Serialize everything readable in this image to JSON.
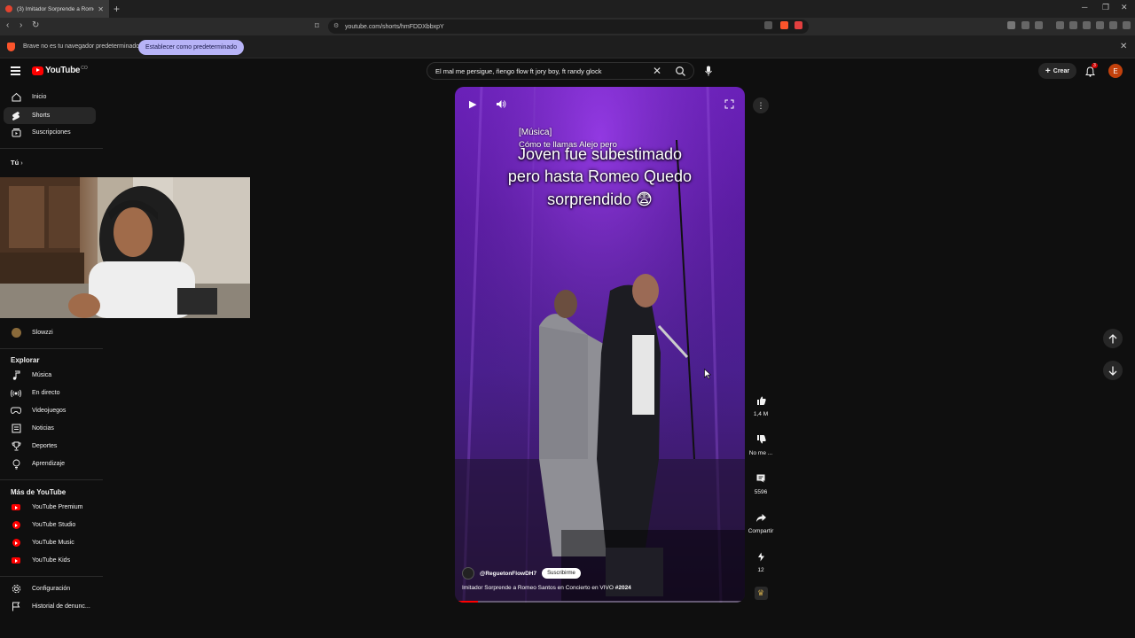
{
  "browser": {
    "tab_title": "(3) Imitador Sorprende a Romeo",
    "url": "youtube.com/shorts/hmFDDXbbxpY",
    "notification_message": "Brave no es tu navegador predeterminado",
    "set_default_label": "Establecer como predeterminado"
  },
  "header": {
    "logo_text": "YouTube",
    "logo_suffix": "CO",
    "search_query": "El mal me persigue, ñengo flow ft jory boy, ft randy glock",
    "create_label": "Crear",
    "notification_count": "3",
    "avatar_letter": "E"
  },
  "sidebar": {
    "main": [
      {
        "label": "Inicio",
        "icon": "home-icon"
      },
      {
        "label": "Shorts",
        "icon": "shorts-icon",
        "active": true
      },
      {
        "label": "Suscripciones",
        "icon": "subscriptions-icon"
      }
    ],
    "you_label": "Tú",
    "subscription_item": "Slowzzi",
    "explore_heading": "Explorar",
    "explore": [
      {
        "label": "Música",
        "icon": "music-icon"
      },
      {
        "label": "En directo",
        "icon": "live-icon"
      },
      {
        "label": "Videojuegos",
        "icon": "gaming-icon"
      },
      {
        "label": "Noticias",
        "icon": "news-icon"
      },
      {
        "label": "Deportes",
        "icon": "trophy-icon"
      },
      {
        "label": "Aprendizaje",
        "icon": "bulb-icon"
      }
    ],
    "more_heading": "Más de YouTube",
    "more": [
      {
        "label": "YouTube Premium",
        "icon": "youtube-premium-icon"
      },
      {
        "label": "YouTube Studio",
        "icon": "youtube-studio-icon"
      },
      {
        "label": "YouTube Music",
        "icon": "youtube-music-icon"
      },
      {
        "label": "YouTube Kids",
        "icon": "youtube-kids-icon"
      }
    ],
    "bottom": [
      {
        "label": "Configuración",
        "icon": "settings-icon"
      },
      {
        "label": "Historial de denunc...",
        "icon": "flag-icon"
      }
    ]
  },
  "video": {
    "caption_line1": "[Música]",
    "caption_line2": "Cómo te llamas Alejo pero",
    "overlay_text_1": "Joven fue subestimado",
    "overlay_text_2": "pero hasta Romeo Quedo",
    "overlay_text_3": "sorprendido 😨",
    "channel": "@ReguetonFlowDH7",
    "subscribe_label": "Suscribirme",
    "title": "Imitador Sorprende a Romeo Santos en Concierto en VIVO",
    "hashtag": "#2024",
    "progress": 0.08
  },
  "actions": {
    "likes": "1,4 M",
    "dislike_label": "No me ...",
    "comments": "5596",
    "share_label": "Compartir",
    "remix_count": "12"
  },
  "colors": {
    "background": "#0f0f0f",
    "accent_red": "#ff0000",
    "video_purple": "#6d1fc1"
  }
}
